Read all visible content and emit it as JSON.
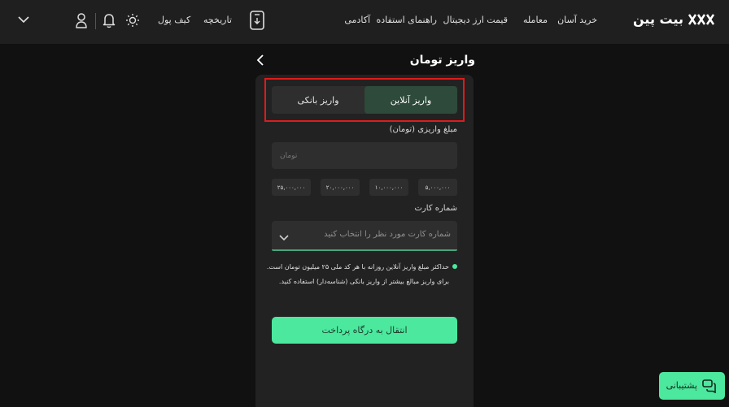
{
  "navbar": {
    "logo_text": "بیت پین",
    "links": [
      "خرید آسان",
      "معامله",
      "قیمت ارز دیجیتال",
      "راهنمای استفاده",
      "آکادمی"
    ],
    "history_label": "تاریخچه",
    "wallet_label": "کیف پول"
  },
  "deposit": {
    "title": "واریز تومان",
    "tabs": [
      {
        "label": "واریز آنلاین",
        "active": true
      },
      {
        "label": "واریز بانکی",
        "active": false
      }
    ],
    "amount_label": "مبلغ واریزی (تومان)",
    "amount_placeholder": "تومان",
    "quick_amounts": [
      "۵,۰۰۰,۰۰۰",
      "۱۰,۰۰۰,۰۰۰",
      "۲۰,۰۰۰,۰۰۰",
      "۲۵,۰۰۰,۰۰۰"
    ],
    "card_label": "شماره کارت",
    "card_placeholder": "شماره کارت مورد نظر را انتخاب کنید",
    "note_line1": "حداکثر مبلغ واریز آنلاین روزانه با هر کد ملی ۲۵ میلیون تومان است.",
    "note_line2": "برای واریز مبالغ بیشتر از واریز بانکی (شناسه‌دار) استفاده کنید.",
    "submit_label": "انتقال به درگاه پرداخت"
  },
  "support": {
    "label": "پشتیبانی"
  },
  "colors": {
    "accent": "#4be89e",
    "highlight": "#e01b1b",
    "active_tab": "#2d4a3a"
  }
}
